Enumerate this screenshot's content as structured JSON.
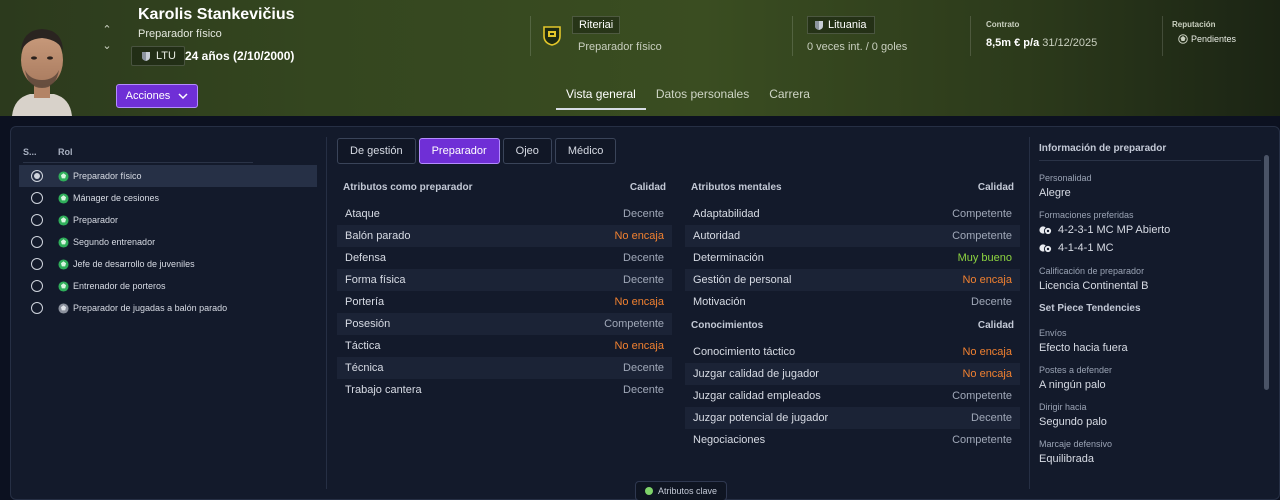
{
  "header": {
    "name": "Karolis Stankevičius",
    "role": "Preparador físico",
    "nationality_code": "LTU",
    "age": "24 años (2/10/2000)",
    "actions_label": "Acciones",
    "club": {
      "name": "Riteriai",
      "role": "Preparador físico"
    },
    "country": {
      "name": "Lituania",
      "caps": "0 veces int. / 0 goles"
    },
    "contract": {
      "label": "Contrato",
      "wage": "8,5m € p/a",
      "expiry": "31/12/2025"
    },
    "reputation": {
      "label": "Reputación",
      "value": "Pendientes"
    },
    "tabs": [
      "Vista general",
      "Datos personales",
      "Carrera"
    ]
  },
  "roles": {
    "col_select": "S...",
    "col_role": "Rol",
    "items": [
      {
        "label": "Preparador físico",
        "selected": true
      },
      {
        "label": "Mánager de cesiones",
        "selected": false
      },
      {
        "label": "Preparador",
        "selected": false
      },
      {
        "label": "Segundo entrenador",
        "selected": false
      },
      {
        "label": "Jefe de desarrollo de juveniles",
        "selected": false
      },
      {
        "label": "Entrenador de porteros",
        "selected": false
      },
      {
        "label": "Preparador de jugadas a balón parado",
        "selected": false
      }
    ]
  },
  "subtabs": [
    "De gestión",
    "Preparador",
    "Ojeo",
    "Médico"
  ],
  "coaching": {
    "title": "Atributos como preparador",
    "quality_label": "Calidad",
    "rows": [
      {
        "name": "Ataque",
        "value": "Decente"
      },
      {
        "name": "Balón parado",
        "value": "No encaja"
      },
      {
        "name": "Defensa",
        "value": "Decente"
      },
      {
        "name": "Forma física",
        "value": "Decente"
      },
      {
        "name": "Portería",
        "value": "No encaja"
      },
      {
        "name": "Posesión",
        "value": "Competente"
      },
      {
        "name": "Táctica",
        "value": "No encaja"
      },
      {
        "name": "Técnica",
        "value": "Decente"
      },
      {
        "name": "Trabajo cantera",
        "value": "Decente"
      }
    ]
  },
  "mental": {
    "title": "Atributos mentales",
    "quality_label": "Calidad",
    "rows": [
      {
        "name": "Adaptabilidad",
        "value": "Competente"
      },
      {
        "name": "Autoridad",
        "value": "Competente"
      },
      {
        "name": "Determinación",
        "value": "Muy bueno"
      },
      {
        "name": "Gestión de personal",
        "value": "No encaja"
      },
      {
        "name": "Motivación",
        "value": "Decente"
      }
    ]
  },
  "knowledge": {
    "title": "Conocimientos",
    "quality_label": "Calidad",
    "rows": [
      {
        "name": "Conocimiento táctico",
        "value": "No encaja"
      },
      {
        "name": "Juzgar calidad de jugador",
        "value": "No encaja"
      },
      {
        "name": "Juzgar calidad empleados",
        "value": "Competente"
      },
      {
        "name": "Juzgar potencial de jugador",
        "value": "Decente"
      },
      {
        "name": "Negociaciones",
        "value": "Competente"
      }
    ]
  },
  "info": {
    "title": "Información de preparador",
    "personality_label": "Personalidad",
    "personality": "Alegre",
    "formations_label": "Formaciones preferidas",
    "formations": [
      "4-2-3-1 MC MP Abierto",
      "4-1-4-1 MC"
    ],
    "qualification_label": "Calificación de preparador",
    "qualification": "Licencia Continental B",
    "set_piece_title": "Set Piece Tendencies",
    "deliveries_label": "Envíos",
    "deliveries": "Efecto hacia fuera",
    "posts_label": "Postes a defender",
    "posts": "A ningún palo",
    "aim_label": "Dirigir hacia",
    "aim": "Segundo palo",
    "marking_label": "Marcaje defensivo",
    "marking": "Equilibrada"
  },
  "key_attributes_label": "Atributos clave",
  "colors": {
    "accent": "#6f2fd6",
    "bad": "#f08030",
    "good": "#8dd440",
    "neutral": "#a0a8b8"
  }
}
